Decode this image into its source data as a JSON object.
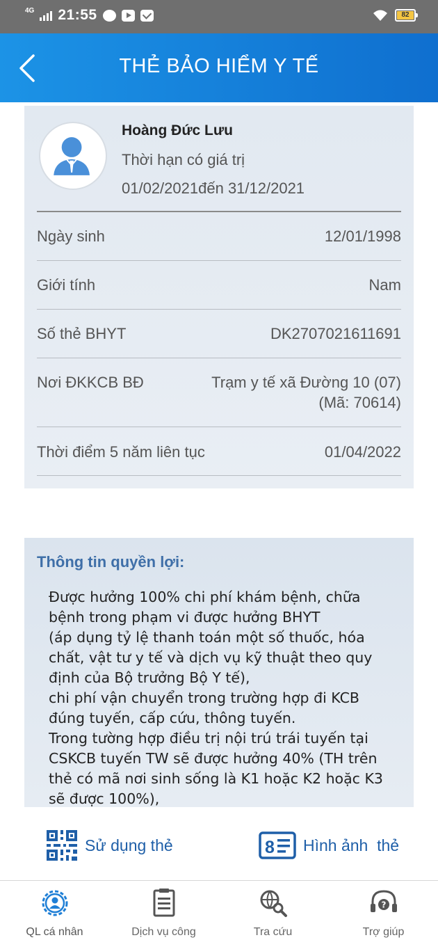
{
  "status_bar": {
    "network": "4G",
    "time": "21:55",
    "battery": "82",
    "icons": [
      "messenger-icon",
      "youtube-icon",
      "mail-icon",
      "wifi-icon",
      "battery-icon"
    ]
  },
  "header": {
    "title": "THẺ BẢO HIỂM Y TẾ",
    "back_icon": "chevron-left-icon"
  },
  "card": {
    "name": "Hoàng Đức Lưu",
    "validity_label": "Thời hạn có giá trị",
    "valid_from": "01/02/2021",
    "valid_to_sep": "đến ",
    "valid_to": "31/12/2021",
    "rows": [
      {
        "label": "Ngày sinh",
        "value": "12/01/1998"
      },
      {
        "label": "Giới tính",
        "value": "Nam"
      },
      {
        "label": "Số thẻ BHYT",
        "value": "DK2707021611691"
      },
      {
        "label": "Nơi ĐKKCB BĐ",
        "value": "Trạm y tế xã Đường 10 (07)",
        "value2": "(Mã: 70614)"
      },
      {
        "label": "Thời điểm 5 năm liên tục",
        "value": "01/04/2022"
      }
    ]
  },
  "benefits": {
    "title": "Thông tin quyền lợi:",
    "paragraphs": [
      "Được hưởng 100% chi phí khám bệnh, chữa bệnh trong phạm vi được hưởng BHYT",
      "(áp dụng tỷ lệ thanh toán một số thuốc, hóa chất, vật tư y tế và dịch vụ kỹ thuật theo quy định của Bộ trưởng Bộ Y tế),",
      "chi phí vận chuyển trong trường hợp đi KCB đúng tuyến, cấp cứu, thông tuyến.",
      "Trong tường hợp điều trị nội trú trái tuyến tại CSKCB tuyến TW sẽ được hưởng 40% (TH trên thẻ có mã nơi sinh sống là K1 hoặc K2 hoặc K3 sẽ được 100%),"
    ]
  },
  "actions": {
    "use_card": "Sử dụng thẻ",
    "card_image": "Hình ảnh  thẻ"
  },
  "bottom_nav": [
    {
      "label": "QL cá nhân",
      "icon": "profile-gear-icon",
      "active": true
    },
    {
      "label": "Dịch vụ công",
      "icon": "document-icon",
      "active": false
    },
    {
      "label": "Tra cứu",
      "icon": "globe-search-icon",
      "active": false
    },
    {
      "label": "Trợ giúp",
      "icon": "headset-help-icon",
      "active": false
    }
  ],
  "colors": {
    "header_start": "#1c93e6",
    "header_end": "#0f6fcf",
    "accent_text": "#1f5fa8",
    "card_bg": "#e5ebf2"
  }
}
